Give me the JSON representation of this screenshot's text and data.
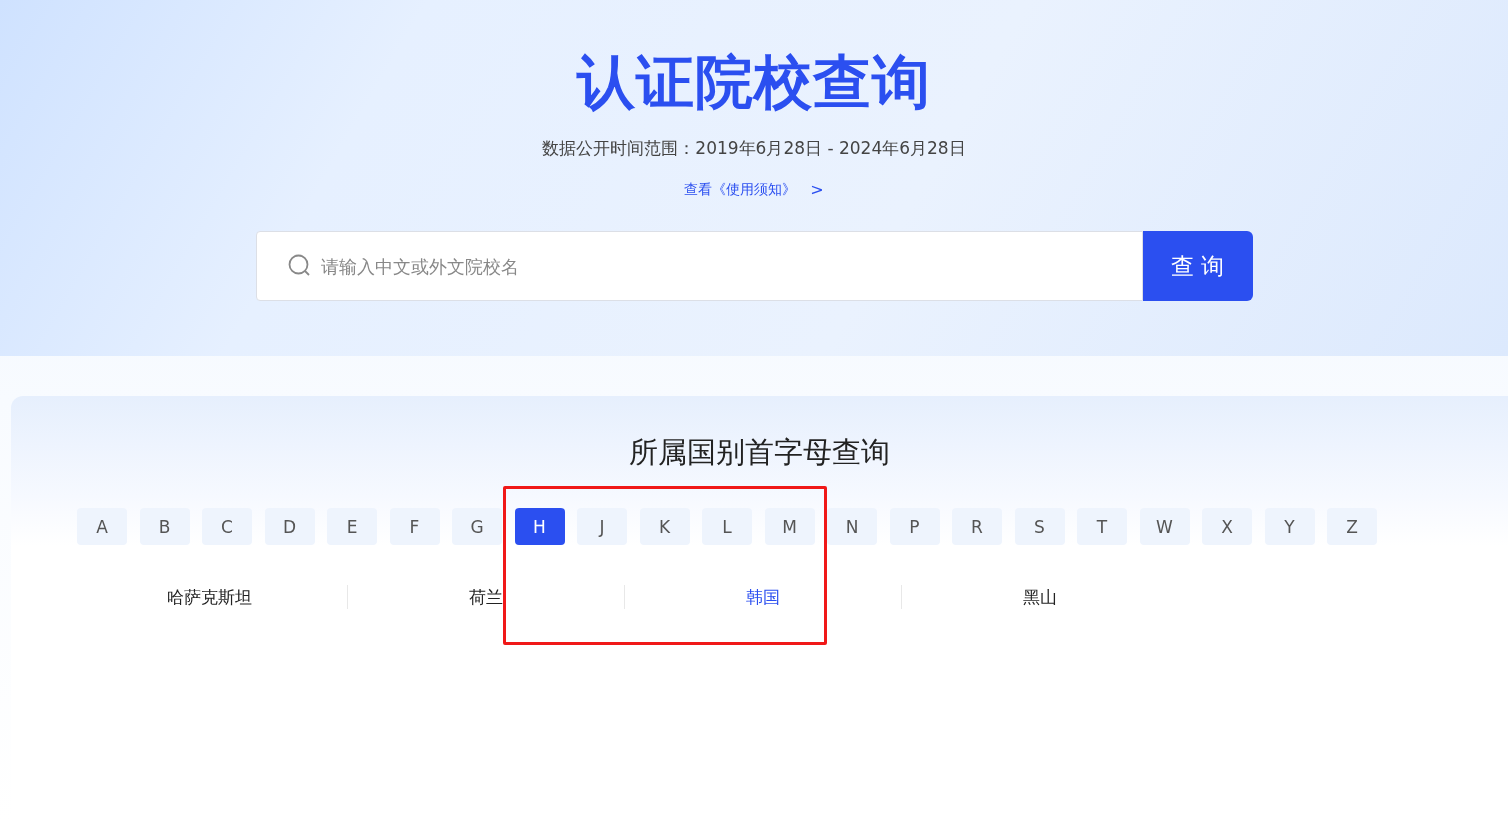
{
  "header": {
    "title": "认证院校查询",
    "date_range": "数据公开时间范围：2019年6月28日 - 2024年6月28日",
    "notice_link": "查看《使用须知》",
    "notice_arrow": ">"
  },
  "search": {
    "placeholder": "请输入中文或外文院校名",
    "button": "查 询"
  },
  "letter_section": {
    "title": "所属国别首字母查询",
    "letters": [
      {
        "label": "A",
        "selected": false
      },
      {
        "label": "B",
        "selected": false
      },
      {
        "label": "C",
        "selected": false
      },
      {
        "label": "D",
        "selected": false
      },
      {
        "label": "E",
        "selected": false
      },
      {
        "label": "F",
        "selected": false
      },
      {
        "label": "G",
        "selected": false
      },
      {
        "label": "H",
        "selected": true
      },
      {
        "label": "J",
        "selected": false
      },
      {
        "label": "K",
        "selected": false
      },
      {
        "label": "L",
        "selected": false
      },
      {
        "label": "M",
        "selected": false
      },
      {
        "label": "N",
        "selected": false
      },
      {
        "label": "P",
        "selected": false
      },
      {
        "label": "R",
        "selected": false
      },
      {
        "label": "S",
        "selected": false
      },
      {
        "label": "T",
        "selected": false
      },
      {
        "label": "W",
        "selected": false
      },
      {
        "label": "X",
        "selected": false
      },
      {
        "label": "Y",
        "selected": false
      },
      {
        "label": "Z",
        "selected": false
      }
    ],
    "countries": [
      {
        "name": "哈萨克斯坦",
        "selected": false
      },
      {
        "name": "荷兰",
        "selected": false
      },
      {
        "name": "韩国",
        "selected": true
      },
      {
        "name": "黑山",
        "selected": false
      }
    ]
  }
}
